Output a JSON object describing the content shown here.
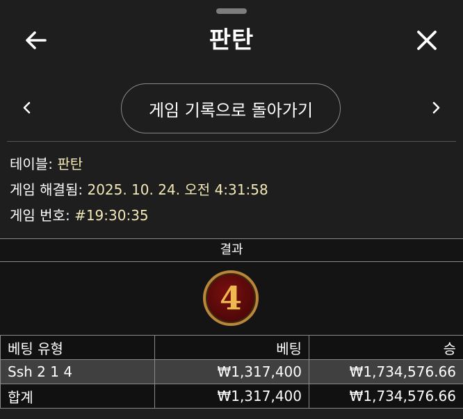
{
  "header": {
    "title": "판탄",
    "back_icon": "arrow-left-icon",
    "close_icon": "close-x-icon"
  },
  "nav": {
    "back_to_history_label": "게임 기록으로 돌아가기",
    "prev_icon": "chevron-left-icon",
    "next_icon": "chevron-right-icon"
  },
  "info": {
    "table_label": "테이블:",
    "table_value": "판탄",
    "resolved_label": "게임 해결됨:",
    "resolved_value": "2025. 10. 24. 오전 4:31:58",
    "game_no_label": "게임 번호:",
    "game_no_value": "#19:30:35"
  },
  "result": {
    "header_label": "결과",
    "value": "4"
  },
  "bets_table": {
    "columns": [
      "베팅 유형",
      "베팅",
      "승"
    ],
    "rows": [
      {
        "type": "Ssh 2 1 4",
        "bet": "₩1,317,400",
        "win": "₩1,734,576.66"
      }
    ],
    "total": {
      "label": "합계",
      "bet": "₩1,317,400",
      "win": "₩1,734,576.66"
    }
  },
  "colors": {
    "background": "#1e1e1e",
    "value_text": "#f3e9b8",
    "badge_red": "#5a0808",
    "badge_gold": "#b8873a",
    "highlight_row": "#404040"
  }
}
